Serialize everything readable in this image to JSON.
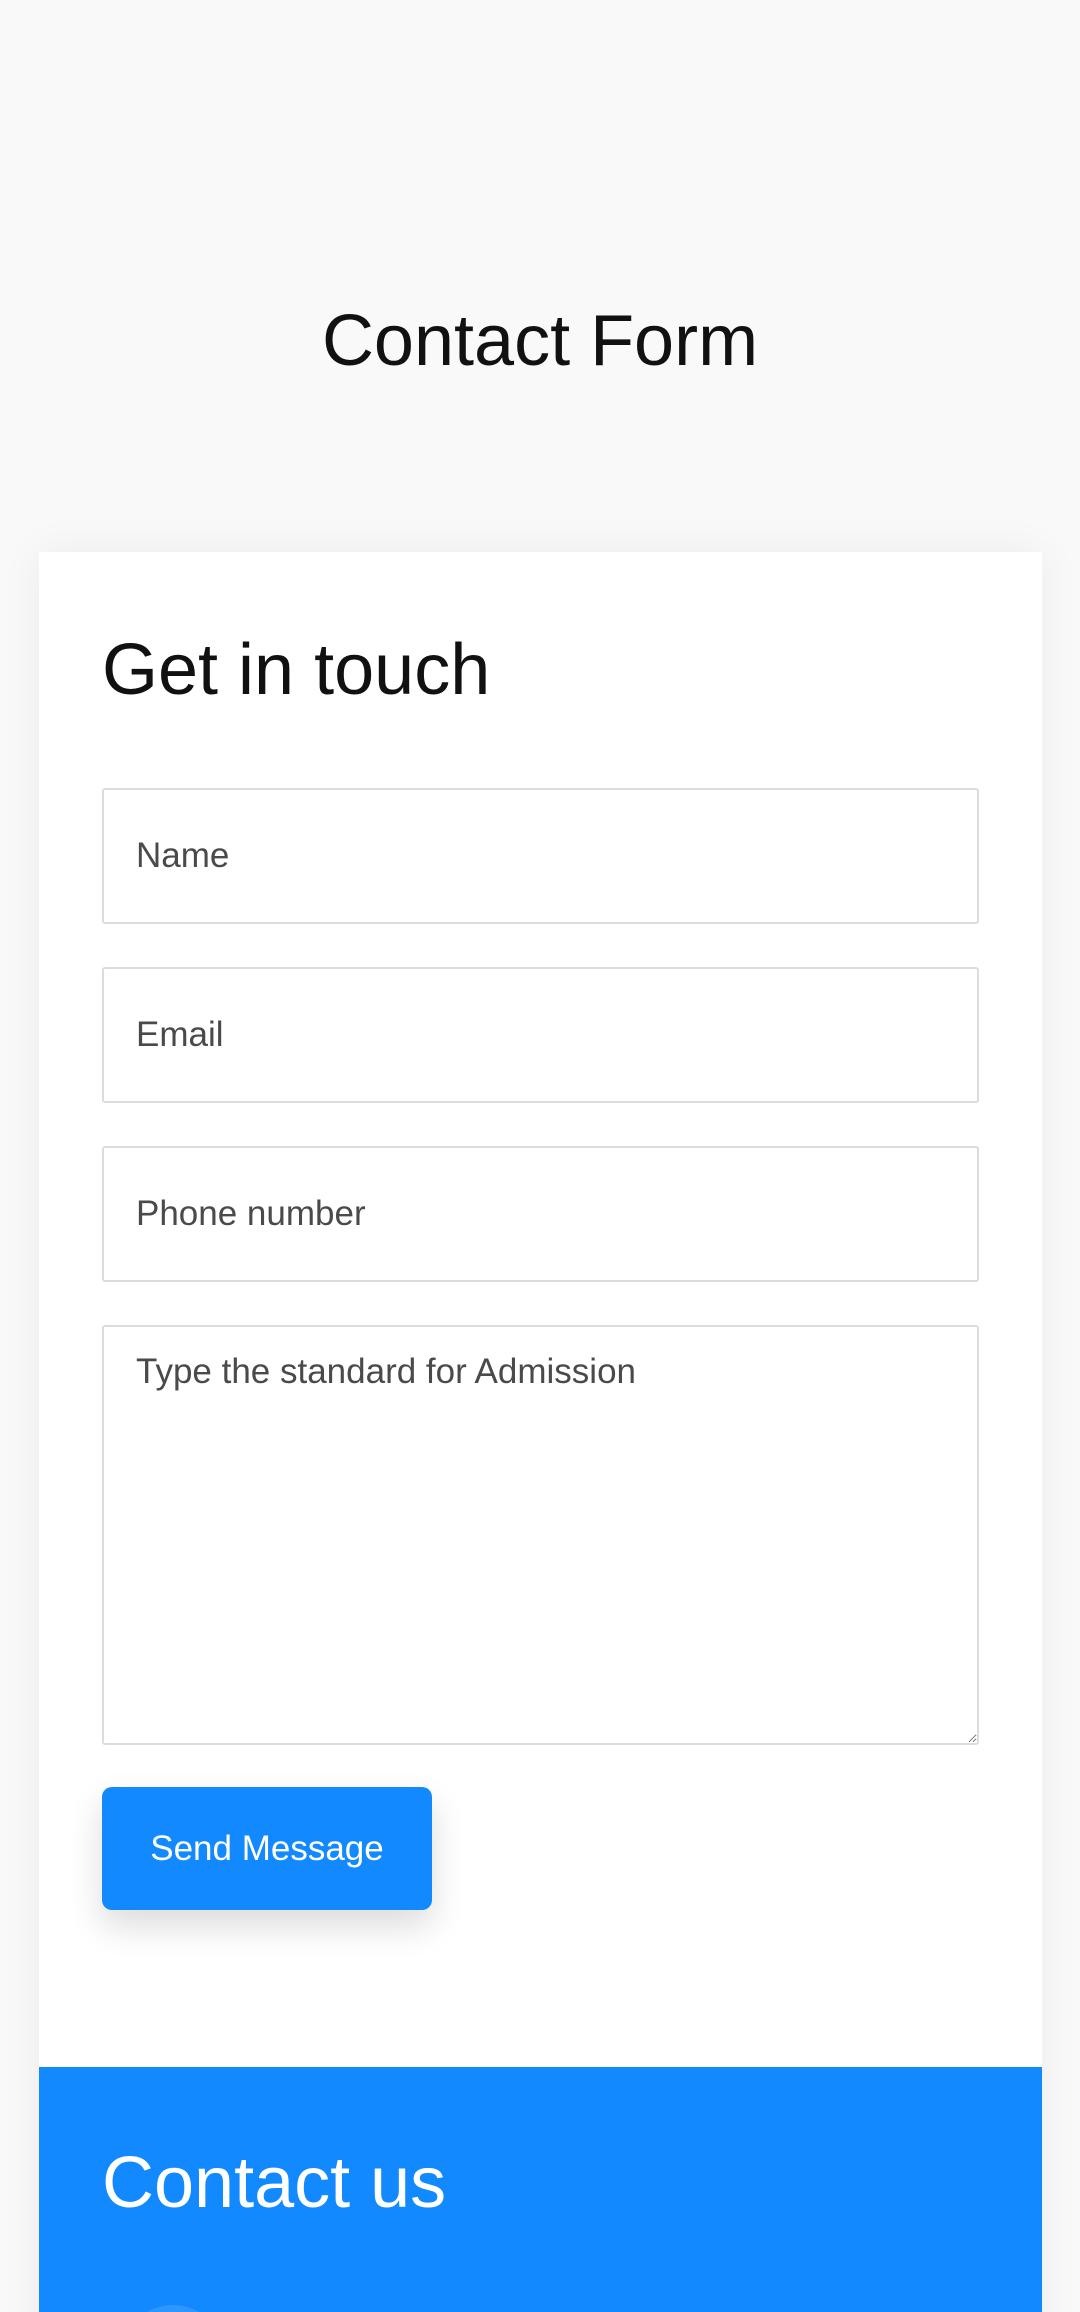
{
  "header": {
    "title": "Contact Form"
  },
  "form": {
    "heading": "Get in touch",
    "name_placeholder": "Name",
    "email_placeholder": "Email",
    "phone_placeholder": "Phone number",
    "message_placeholder": "Type the standard for Admission",
    "submit_label": "Send Message"
  },
  "contact": {
    "heading": "Contact us",
    "icon": "contact-icon"
  },
  "colors": {
    "accent": "#1289fe",
    "page_background": "#f9f9f9",
    "card_background": "#ffffff"
  }
}
